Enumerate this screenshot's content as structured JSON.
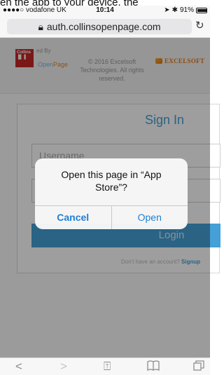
{
  "top_banner": {
    "text": "en the app to your device, the"
  },
  "status_bar": {
    "carrier": "●●●●○ vodafone UK",
    "time": "10:14",
    "battery": "91%",
    "battery_level": 0.91
  },
  "browser": {
    "url": "auth.collinsopenpage.com"
  },
  "header": {
    "logo_by": "ed By",
    "logo_open": "Open",
    "logo_page": "Page",
    "copyright": "© 2016 Excelsoft Technologies. All rights reserved.",
    "excelsoft": "EXCELSOFT"
  },
  "signin": {
    "title": "Sign In",
    "username_placeholder": "Username",
    "password_placeholder": "",
    "login_label": "Login",
    "signup_prompt": "Don't have an account?",
    "signup_link": "Signup"
  },
  "dialog": {
    "message": "Open this page in “App Store”?",
    "cancel_label": "Cancel",
    "open_label": "Open"
  },
  "toolbar": {
    "back": "<",
    "forward": ">",
    "share": "⍐",
    "bookmarks": "📖",
    "tabs": "⧉"
  }
}
